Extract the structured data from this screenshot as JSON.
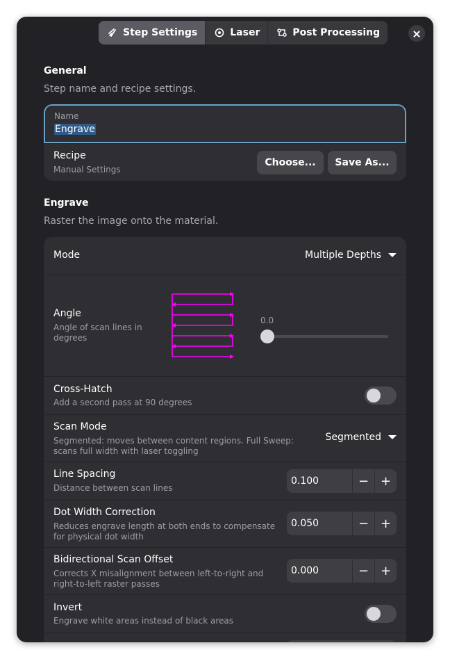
{
  "tabs": [
    {
      "label": "Step Settings",
      "icon": "brush-icon",
      "active": true
    },
    {
      "label": "Laser",
      "icon": "target-icon",
      "active": false
    },
    {
      "label": "Post Processing",
      "icon": "workflow-icon",
      "active": false
    }
  ],
  "general": {
    "title": "General",
    "description": "Step name and recipe settings.",
    "name_label": "Name",
    "name_value": "Engrave",
    "recipe_title": "Recipe",
    "recipe_subtitle": "Manual Settings",
    "choose_button": "Choose...",
    "save_as_button": "Save As..."
  },
  "engrave": {
    "title": "Engrave",
    "description": "Raster the image onto the material.",
    "mode": {
      "label": "Mode",
      "value": "Multiple Depths"
    },
    "angle": {
      "label": "Angle",
      "description": "Angle of scan lines in degrees",
      "value": "0.0",
      "slider_fraction": 0.0
    },
    "cross_hatch": {
      "label": "Cross-Hatch",
      "description": "Add a second pass at 90 degrees",
      "enabled": false
    },
    "scan_mode": {
      "label": "Scan Mode",
      "description": "Segmented: moves between content regions. Full Sweep: scans full width with laser toggling",
      "value": "Segmented"
    },
    "line_spacing": {
      "label": "Line Spacing",
      "description": "Distance between scan lines",
      "value": "0.100"
    },
    "dot_width": {
      "label": "Dot Width Correction",
      "description": "Reduces engrave length at both ends to compensate for physical dot width",
      "value": "0.050"
    },
    "bidirectional": {
      "label": "Bidirectional Scan Offset",
      "description": "Corrects X misalignment between left-to-right and right-to-left raster passes",
      "value": "0.000"
    },
    "invert": {
      "label": "Invert",
      "description": "Engrave white areas instead of black areas",
      "enabled": false
    }
  },
  "colors": {
    "window_bg": "#222226",
    "card_bg": "#2e2e33",
    "focus_border": "#6aa2c8",
    "scan_preview": "#ff00ff"
  }
}
